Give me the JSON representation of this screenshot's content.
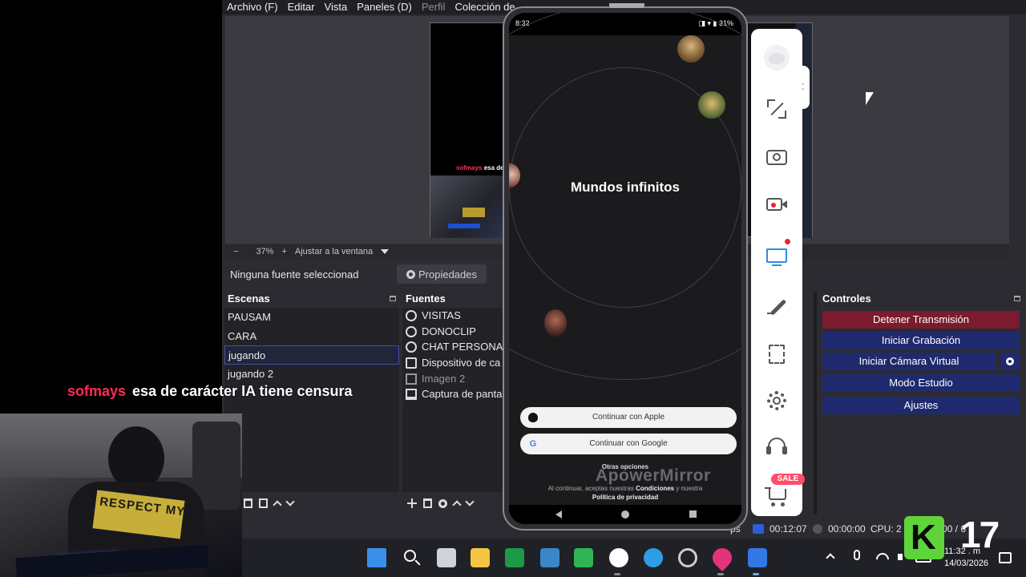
{
  "menubar": {
    "items": [
      "Archivo (F)",
      "Editar",
      "Vista",
      "Paneles (D)",
      "Perfil",
      "Colección de"
    ]
  },
  "preview": {
    "mini_chat_user": "sofmays",
    "mini_chat_text": "esa de c"
  },
  "zoombar": {
    "minus": "−",
    "zoom": "37%",
    "plus": "+",
    "fit": "Ajustar a la ventana"
  },
  "propbar": {
    "no_source": "Ninguna fuente seleccionad",
    "properties": "Propiedades"
  },
  "scenes": {
    "title": "Escenas",
    "items": [
      "PAUSAM",
      "CARA",
      "jugando",
      "jugando 2"
    ],
    "selected": "jugando"
  },
  "sources": {
    "title": "Fuentes",
    "items": [
      {
        "label": "VISITAS",
        "icon": "globe-icon"
      },
      {
        "label": "DONOCLIP",
        "icon": "globe-icon"
      },
      {
        "label": "CHAT PERSONAL",
        "icon": "globe-icon"
      },
      {
        "label": "Dispositivo de ca",
        "icon": "camera-icon"
      },
      {
        "label": "Imagen 2",
        "icon": "image-icon"
      },
      {
        "label": "Captura de panta",
        "icon": "monitor-icon"
      }
    ]
  },
  "controls": {
    "title": "Controles",
    "stop_stream": "Detener Transmisión",
    "start_recording": "Iniciar Grabación",
    "start_virtual_cam": "Iniciar Cámara Virtual",
    "studio_mode": "Modo Estudio",
    "settings": "Ajustes"
  },
  "statusbar": {
    "fps_tail": "ps",
    "live_time": "00:12:07",
    "rec_time": "00:00:00",
    "cpu": "CPU: 2",
    "tail": "00 / 6"
  },
  "chat_overlay": {
    "user": "sofmays",
    "message": "esa de carácter IA tiene censura"
  },
  "webcam": {
    "shirt_text": "RESPECT MY"
  },
  "phone": {
    "status_time": "8:32",
    "status_right": "◨ ▾ ▮ 31%",
    "app_title": "Mundos infinitos",
    "apple_button": "Continuar con Apple",
    "google_button": "Continuar con Google",
    "other_options": "Otras opciones",
    "terms_prefix": "Al continuar, aceptas nuestras",
    "terms_conditions": "Condiciones",
    "terms_and": "y nuestra",
    "terms_privacy": "Política de privacidad",
    "watermark": "ApowerMirror"
  },
  "mirror_toolbar": {
    "items": [
      "logo-icon",
      "fullscreen-icon",
      "screenshot-icon",
      "record-icon",
      "cast-icon",
      "brush-icon",
      "crop-icon",
      "settings-icon",
      "support-icon",
      "cart-icon"
    ],
    "sale_badge": "SALE"
  },
  "taskbar": {
    "clock_time": "11:32 . m",
    "clock_date": "14/03/2026"
  },
  "logo": {
    "letter": "K",
    "number": "17"
  },
  "colors": {
    "stop_button": "#7a1b30",
    "control_button": "#1f2a6e",
    "chat_user": "#ff2b56",
    "logo_green": "#5fd33a"
  }
}
